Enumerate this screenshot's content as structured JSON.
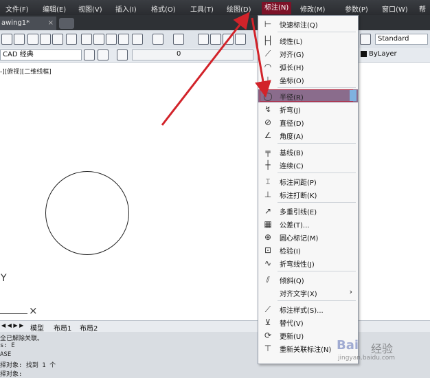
{
  "menubar": {
    "items": [
      "文件(F)",
      "编辑(E)",
      "视图(V)",
      "插入(I)",
      "格式(O)",
      "工具(T)",
      "绘图(D)",
      "标注(N)",
      "修改(M)",
      "参数(P)",
      "窗口(W)",
      "帮"
    ],
    "active": "标注(N)"
  },
  "doc_tab": {
    "title": "awing1*",
    "close": "×"
  },
  "toolbar": {
    "style_combo": "Standard",
    "workspace_combo": "CAD 经典",
    "layer_value": "0",
    "linetype_combo": "ByLayer"
  },
  "canvas": {
    "view_label": "-][俯视][二维线框]",
    "y_axis": "Y",
    "x_mark": "×"
  },
  "layout_tabs": {
    "model": "模型",
    "layout1": "布局1",
    "layout2": "布局2"
  },
  "command_lines": [
    "全已解除关联。",
    "s: E",
    "ASE",
    "择对象: 找到 1 个",
    "择对象:"
  ],
  "dropdown": {
    "items": [
      {
        "label": "快速标注(Q)",
        "icon": "quick-dim-icon"
      },
      {
        "label": "线性(L)",
        "icon": "linear-icon"
      },
      {
        "label": "对齐(G)",
        "icon": "aligned-icon"
      },
      {
        "label": "弧长(H)",
        "icon": "arc-length-icon"
      },
      {
        "label": "坐标(O)",
        "icon": "ordinate-icon"
      },
      {
        "label": "半径(R)",
        "icon": "radius-icon",
        "highlighted": true
      },
      {
        "label": "折弯(J)",
        "icon": "jogged-icon"
      },
      {
        "label": "直径(D)",
        "icon": "diameter-icon"
      },
      {
        "label": "角度(A)",
        "icon": "angular-icon"
      },
      {
        "label": "基线(B)",
        "icon": "baseline-icon"
      },
      {
        "label": "连续(C)",
        "icon": "continue-icon"
      },
      {
        "label": "标注间距(P)",
        "icon": "dim-space-icon"
      },
      {
        "label": "标注打断(K)",
        "icon": "dim-break-icon"
      },
      {
        "label": "多重引线(E)",
        "icon": "multileader-icon"
      },
      {
        "label": "公差(T)...",
        "icon": "tolerance-icon"
      },
      {
        "label": "圆心标记(M)",
        "icon": "center-mark-icon"
      },
      {
        "label": "检验(I)",
        "icon": "inspect-icon"
      },
      {
        "label": "折弯线性(J)",
        "icon": "jogged-linear-icon"
      },
      {
        "label": "倾斜(Q)",
        "icon": "oblique-icon"
      },
      {
        "label": "对齐文字(X)",
        "icon": "align-text-icon",
        "submenu": true
      },
      {
        "label": "标注样式(S)...",
        "icon": "dim-style-icon"
      },
      {
        "label": "替代(V)",
        "icon": "override-icon"
      },
      {
        "label": "更新(U)",
        "icon": "update-icon"
      },
      {
        "label": "重新关联标注(N)",
        "icon": "reassociate-icon"
      }
    ]
  },
  "watermark": {
    "brand": "Bai",
    "brand2": "经验",
    "url": "jingyan.baidu.com"
  },
  "colors": {
    "menubar": "#2e3135",
    "active_menu": "#7d1228",
    "highlight": "#8a6c8c",
    "arrow": "#d2232a"
  }
}
